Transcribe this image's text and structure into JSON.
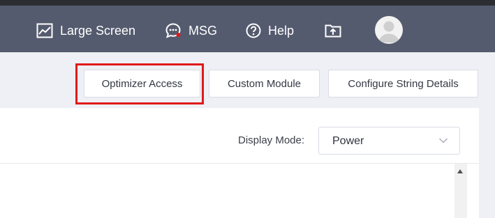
{
  "header": {
    "nav": [
      {
        "label": "Large Screen",
        "icon": "chart-icon"
      },
      {
        "label": "MSG",
        "icon": "chat-icon"
      },
      {
        "label": "Help",
        "icon": "help-icon"
      }
    ],
    "upload_icon": "upload-folder-icon",
    "avatar_icon": "user-avatar-icon"
  },
  "actions": {
    "optimizer_access": "Optimizer Access",
    "custom_module": "Custom Module",
    "configure_string_details": "Configure String Details"
  },
  "display_mode": {
    "label": "Display Mode:",
    "value": "Power"
  },
  "colors": {
    "header_bg": "#555b6e",
    "highlight": "#e0191b",
    "page_bg": "#eef0f5"
  }
}
